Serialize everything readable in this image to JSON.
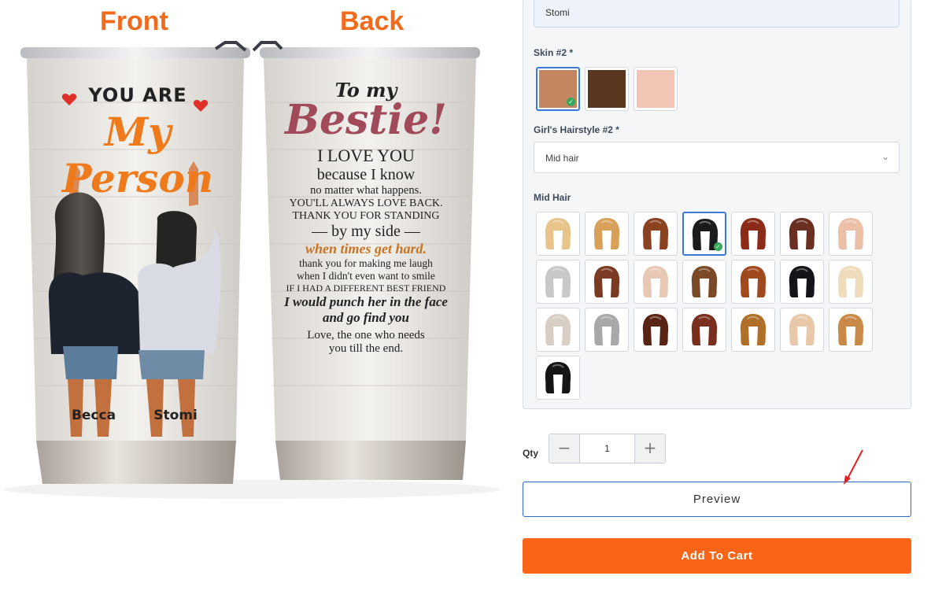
{
  "product": {
    "front_label": "Front",
    "back_label": "Back",
    "front_headline": "YOU ARE",
    "front_script": "My Person",
    "name_left": "Becca",
    "name_right": "Stomi",
    "back_lines": [
      "To my",
      "Bestie!",
      "I LOVE YOU",
      "because I know",
      "no matter what happens.",
      "YOU'LL ALWAYS LOVE BACK.",
      "THANK YOU FOR STANDING",
      "— by my side —",
      "when times get hard.",
      "thank you for making me laugh",
      "when I didn't even want to smile",
      "IF I HAD A DIFFERENT BEST FRIEND",
      "I would punch her in the face",
      "and go find you",
      "Love, the one who needs",
      "you till the end."
    ]
  },
  "options": {
    "name_input_value": "Stomi",
    "skin_label": "Skin #2 *",
    "skin_colors": [
      "#c48561",
      "#5b3720",
      "#f2c6b5"
    ],
    "skin_selected_index": 0,
    "hairstyle_label": "Girl's Hairstyle #2 *",
    "hairstyle_value": "Mid hair",
    "midhair_label": "Mid Hair",
    "hair_colors": [
      "#e8c48a",
      "#d9a05a",
      "#8a4220",
      "#1b1b1b",
      "#8b2b18",
      "#6b2f22",
      "#ecc0a8",
      "#c8c8c8",
      "#7b3a22",
      "#e8c8b4",
      "#7a4a26",
      "#a0481e",
      "#141418",
      "#efdcbc",
      "#d9cec4",
      "#a8a8a8",
      "#5a2414",
      "#7a2e1e",
      "#b0702a",
      "#e8c8a8",
      "#c98a48",
      "#151515"
    ],
    "hair_selected_index": 3
  },
  "purchase": {
    "qty_label": "Qty",
    "qty_minus": "−",
    "qty_value": "1",
    "qty_plus": "+",
    "preview_label": "Preview",
    "add_to_cart_label": "Add To Cart",
    "accent_color": "#fa6417"
  },
  "icons": {
    "dropdown": "chevron-down-icon",
    "selected_mark": "check-icon",
    "annotation": "red-arrow"
  }
}
